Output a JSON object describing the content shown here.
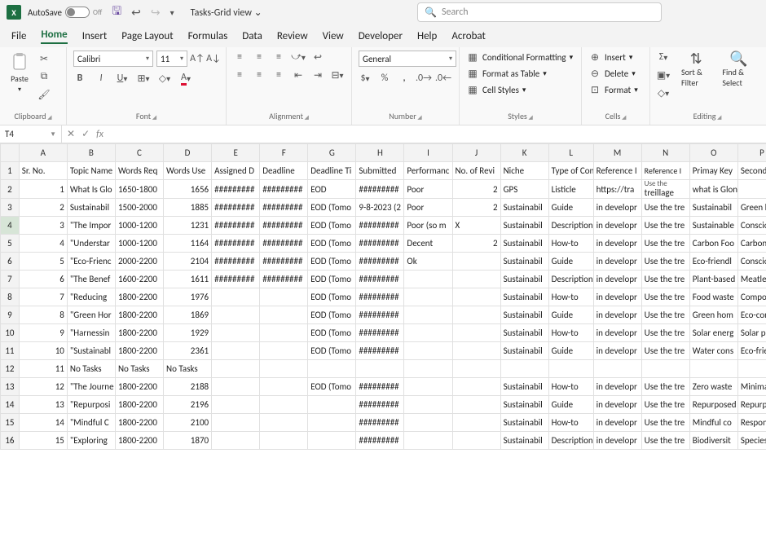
{
  "titlebar": {
    "autosave": "AutoSave",
    "off": "Off",
    "docname": "Tasks-Grid view",
    "chev": "⌄",
    "searchPlaceholder": "Search"
  },
  "menu": {
    "file": "File",
    "home": "Home",
    "insert": "Insert",
    "pageLayout": "Page Layout",
    "formulas": "Formulas",
    "data": "Data",
    "review": "Review",
    "view": "View",
    "developer": "Developer",
    "help": "Help",
    "acrobat": "Acrobat"
  },
  "ribbon": {
    "paste": "Paste",
    "clipboard": "Clipboard",
    "fontName": "Calibri",
    "fontSize": "11",
    "font": "Font",
    "alignment": "Alignment",
    "numberFmt": "General",
    "number": "Number",
    "condFmt": "Conditional Formatting",
    "fmtTable": "Format as Table",
    "cellStyles": "Cell Styles",
    "styles": "Styles",
    "insert": "Insert",
    "delete": "Delete",
    "format": "Format",
    "cells": "Cells",
    "sortFilter": "Sort & Filter",
    "findSelect": "Find & Select",
    "editing": "Editing"
  },
  "namebox": "T4",
  "fx": "fx",
  "cols": [
    "A",
    "B",
    "C",
    "D",
    "E",
    "F",
    "G",
    "H",
    "I",
    "J",
    "K",
    "L",
    "M",
    "N",
    "O",
    "P"
  ],
  "headers": [
    "Sr. No.",
    "Topic Name",
    "Words Req",
    "Words Use",
    "Assigned D",
    "Deadline",
    "Deadline Ti",
    "Submitted",
    "Performanc",
    "No. of Revi",
    "Niche",
    "Type of Con",
    "Reference I",
    "Reference I",
    "Primay Key",
    "Secondary"
  ],
  "row2extra": "Use the",
  "rows": [
    {
      "n": "treillage",
      "a": "1",
      "b": "What Is Glo",
      "c": "1650-1800",
      "d": "1656",
      "e": "#########",
      "f": "#########",
      "g": "EOD",
      "h": "#########",
      "i": "Poor",
      "j": "2",
      "k": "GPS",
      "l": "Listicle",
      "m": "https://tra",
      "o": "what is Glonass GPS",
      "p": ""
    },
    {
      "n": "Use the tre",
      "a": "2",
      "b": "Sustainabil",
      "c": "1500-2000",
      "d": "1885",
      "e": "#########",
      "f": "#########",
      "g": "EOD (Tomo",
      "h": "9-8-2023 (2",
      "i": "Poor",
      "j": "2",
      "k": "Sustainabil",
      "l": "Guide",
      "m": "in developr",
      "o": "Sustainabil",
      "p": "Green livin"
    },
    {
      "n": "Use the tre",
      "a": "3",
      "b": "\"The Impor",
      "c": "1000-1200",
      "d": "1231",
      "e": "#########",
      "f": "#########",
      "g": "EOD (Tomo",
      "h": "#########",
      "i": "Poor (so m",
      "j": "X",
      "k": "Sustainabil",
      "l": "Description",
      "m": "in developr",
      "o": "Sustainable",
      "p": "Conscious l"
    },
    {
      "n": "Use the tre",
      "a": "4",
      "b": "\"Understar",
      "c": "1000-1200",
      "d": "1164",
      "e": "#########",
      "f": "#########",
      "g": "EOD (Tomo",
      "h": "#########",
      "i": "Decent",
      "j": "2",
      "k": "Sustainabil",
      "l": "How-to",
      "m": "in developr",
      "o": "Carbon Foo",
      "p": "Carbon foo"
    },
    {
      "n": "Use the tre",
      "a": "5",
      "b": "\"Eco-Frienc",
      "c": "2000-2200",
      "d": "2104",
      "e": "#########",
      "f": "#########",
      "g": "EOD (Tomo",
      "h": "#########",
      "i": "Ok",
      "j": "",
      "k": "Sustainabil",
      "l": "Guide",
      "m": "in developr",
      "o": "Eco-friendl",
      "p": "Conscious c"
    },
    {
      "n": "Use the tre",
      "a": "6",
      "b": "\"The Benef",
      "c": "1600-2200",
      "d": "1611",
      "e": "#########",
      "f": "#########",
      "g": "EOD (Tomo",
      "h": "#########",
      "i": "",
      "j": "",
      "k": "Sustainabil",
      "l": "Description",
      "m": "in developr",
      "o": "Plant-based",
      "p": "Meatless m"
    },
    {
      "n": "Use the tre",
      "a": "7",
      "b": "\"Reducing",
      "c": "1800-2200",
      "d": "1976",
      "e": "",
      "f": "",
      "g": "EOD (Tomo",
      "h": "#########",
      "i": "",
      "j": "",
      "k": "Sustainabil",
      "l": "How-to",
      "m": "in developr",
      "o": "Food waste",
      "p": "Compostin"
    },
    {
      "n": "Use the tre",
      "a": "8",
      "b": "\"Green Hor",
      "c": "1800-2200",
      "d": "1869",
      "e": "",
      "f": "",
      "g": "EOD (Tomo",
      "h": "#########",
      "i": "",
      "j": "",
      "k": "Sustainabil",
      "l": "Guide",
      "m": "in developr",
      "o": "Green hom",
      "p": "Eco-conscio"
    },
    {
      "n": "Use the tre",
      "a": "9",
      "b": "\"Harnessin",
      "c": "1800-2200",
      "d": "1929",
      "e": "",
      "f": "",
      "g": "EOD (Tomo",
      "h": "#########",
      "i": "",
      "j": "",
      "k": "Sustainabil",
      "l": "How-to",
      "m": "in developr",
      "o": "Solar energ",
      "p": "Solar panel"
    },
    {
      "n": "Use the tre",
      "a": "10",
      "b": "\"Sustainabl",
      "c": "1800-2200",
      "d": "2361",
      "e": "",
      "f": "",
      "g": "EOD (Tomo",
      "h": "#########",
      "i": "",
      "j": "",
      "k": "Sustainabil",
      "l": "Guide",
      "m": "in developr",
      "o": "Water cons",
      "p": "Eco-friendl"
    },
    {
      "n": "",
      "a": "11",
      "b": "No Tasks",
      "c": "No Tasks",
      "d": "No Tasks",
      "e": "",
      "f": "",
      "g": "",
      "h": "",
      "i": "",
      "j": "",
      "k": "",
      "l": "",
      "m": "",
      "o": "",
      "p": ""
    },
    {
      "n": "Use the tre",
      "a": "12",
      "b": "\"The Journe",
      "c": "1800-2200",
      "d": "2188",
      "e": "",
      "f": "",
      "g": "EOD (Tomo",
      "h": "#########",
      "i": "",
      "j": "",
      "k": "Sustainabil",
      "l": "How-to",
      "m": "in developr",
      "o": "Zero waste",
      "p": "Minimalist"
    },
    {
      "n": "Use the tre",
      "a": "13",
      "b": "\"Repurposi",
      "c": "1800-2200",
      "d": "2196",
      "e": "",
      "f": "",
      "g": "",
      "h": "#########",
      "i": "",
      "j": "",
      "k": "Sustainabil",
      "l": "Guide",
      "m": "in developr",
      "o": "Repurposed",
      "p": "Repurposin"
    },
    {
      "n": "Use the tre",
      "a": "14",
      "b": "\"Mindful C",
      "c": "1800-2200",
      "d": "2100",
      "e": "",
      "f": "",
      "g": "",
      "h": "#########",
      "i": "",
      "j": "",
      "k": "Sustainabil",
      "l": "How-to",
      "m": "in developr",
      "o": "Mindful co",
      "p": "Responsible"
    },
    {
      "n": "Use the tre",
      "a": "15",
      "b": "\"Exploring",
      "c": "1800-2200",
      "d": "1870",
      "e": "",
      "f": "",
      "g": "",
      "h": "#########",
      "i": "",
      "j": "",
      "k": "Sustainabil",
      "l": "Description",
      "m": "in developr",
      "o": "Biodiversit",
      "p": "Species div"
    }
  ]
}
